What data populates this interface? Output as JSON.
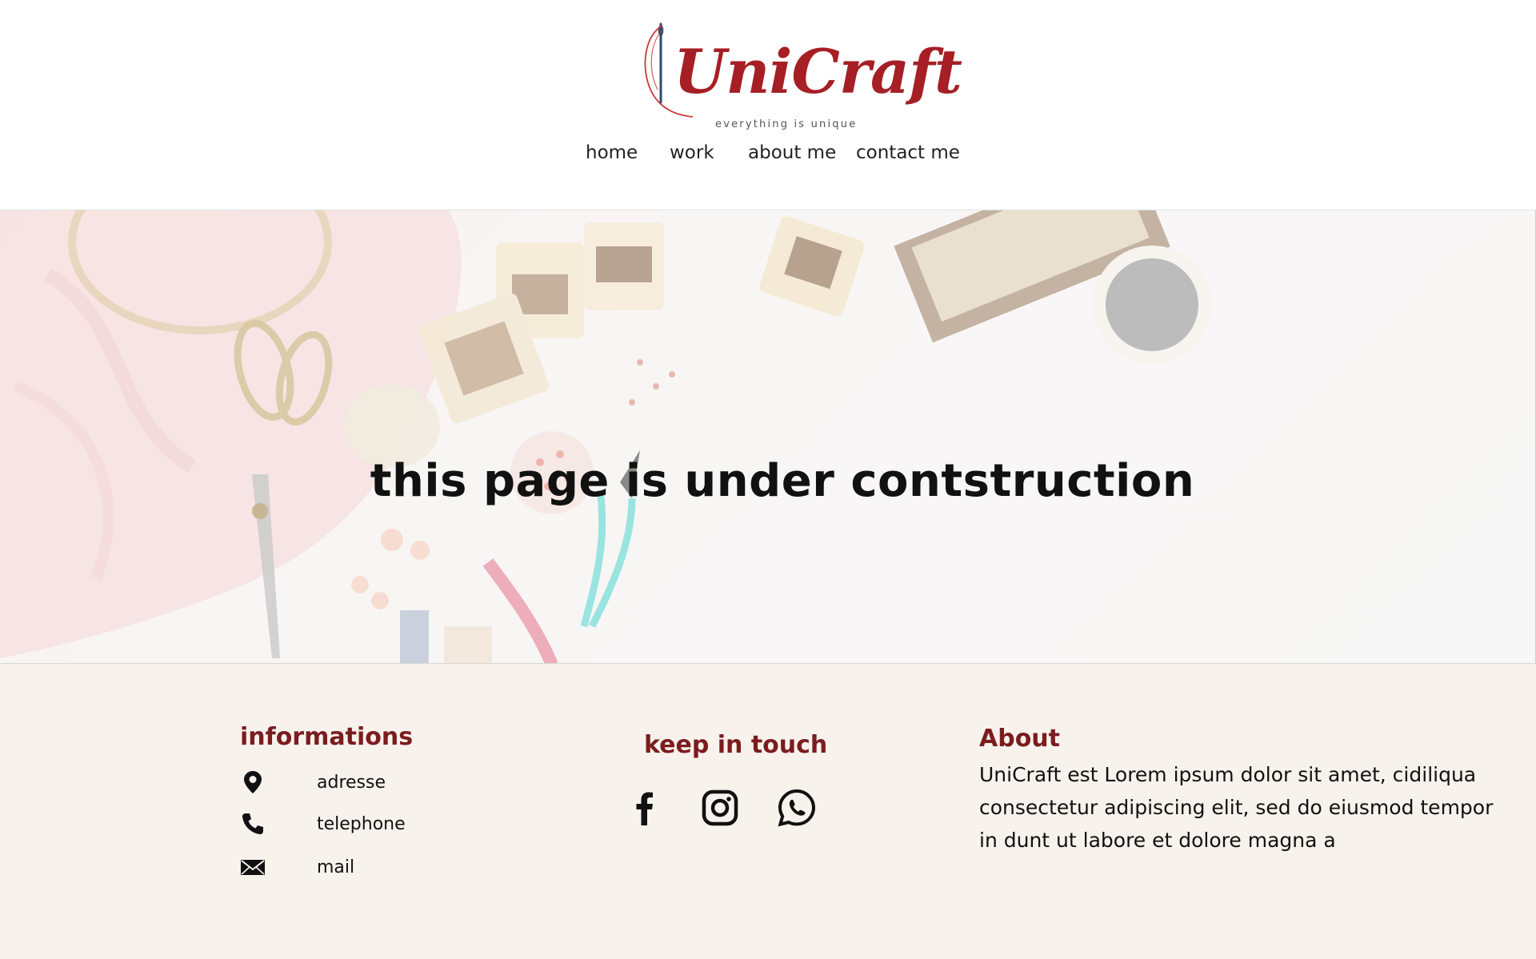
{
  "brand": {
    "name": "UniCraft",
    "tagline": "everything is unique",
    "accent_color": "#a51f24",
    "needle_color": "#2f4a6a",
    "thread_color": "#c93a3a"
  },
  "nav": {
    "items": [
      {
        "label": "home"
      },
      {
        "label": "work"
      },
      {
        "label": "about me"
      },
      {
        "label": "contact me"
      }
    ]
  },
  "hero": {
    "title": "this page is under contstruction"
  },
  "footer": {
    "background": "#f7f2ec",
    "heading_color": "#7b1c1f",
    "informations": {
      "title": "informations",
      "items": [
        {
          "icon": "location-pin-icon",
          "label": "adresse"
        },
        {
          "icon": "phone-icon",
          "label": "telephone"
        },
        {
          "icon": "mail-icon",
          "label": "mail"
        }
      ]
    },
    "keep_in_touch": {
      "title": "keep in touch",
      "socials": [
        {
          "icon": "facebook-icon"
        },
        {
          "icon": "instagram-icon"
        },
        {
          "icon": "whatsapp-icon"
        }
      ]
    },
    "about": {
      "title": "About",
      "text": "UniCraft est Lorem ipsum dolor sit amet, cidiliqua consectetur adipiscing elit, sed do eiusmod tempor in dunt ut labore et dolore magna a"
    }
  }
}
